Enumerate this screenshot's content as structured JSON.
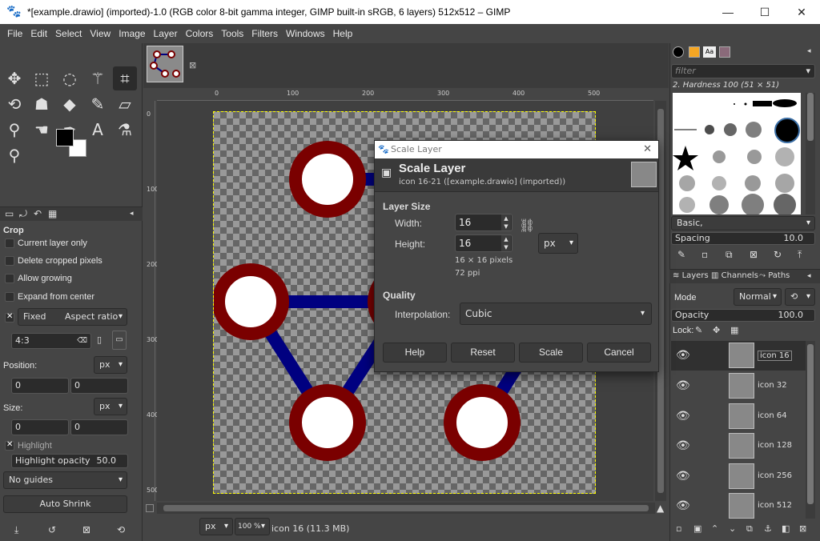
{
  "window": {
    "title": "*[example.drawio] (imported)-1.0 (RGB color 8-bit gamma integer, GIMP built-in sRGB, 6 layers) 512x512 – GIMP",
    "minimize": "—",
    "maximize": "☐",
    "close": "✕"
  },
  "menu": [
    "File",
    "Edit",
    "Select",
    "View",
    "Image",
    "Layer",
    "Colors",
    "Tools",
    "Filters",
    "Windows",
    "Help"
  ],
  "tool_options": {
    "title": "Crop",
    "current_layer_only": "Current layer only",
    "delete_cropped": "Delete cropped pixels",
    "allow_growing": "Allow growing",
    "expand_from_center": "Expand from center",
    "fixed": "Fixed",
    "aspect_ratio": "Aspect ratio",
    "ratio_value": "4:3",
    "position_label": "Position:",
    "position_unit": "px",
    "position_x": "0",
    "position_y": "0",
    "size_label": "Size:",
    "size_unit": "px",
    "size_w": "0",
    "size_h": "0",
    "highlight": "Highlight",
    "highlight_opacity_label": "Highlight opacity",
    "highlight_opacity_value": "50.0",
    "guides": "No guides",
    "auto_shrink": "Auto Shrink"
  },
  "rulers": {
    "top": [
      "0",
      "100",
      "200",
      "300",
      "400",
      "500"
    ],
    "left": [
      "0",
      "100",
      "200",
      "300",
      "400",
      "500"
    ]
  },
  "status": {
    "unit": "px",
    "zoom": "100 %",
    "info": "icon 16 (11.3 MB)"
  },
  "brushes": {
    "filter_placeholder": "filter",
    "selected": "2. Hardness 100 (51 × 51)",
    "preset": "Basic,",
    "spacing_label": "Spacing",
    "spacing_value": "10.0"
  },
  "layers_panel": {
    "tabs": [
      "Layers",
      "Channels",
      "Paths"
    ],
    "mode_label": "Mode",
    "mode_value": "Normal",
    "opacity_label": "Opacity",
    "opacity_value": "100.0",
    "lock_label": "Lock:",
    "layers": [
      "icon 16",
      "icon 32",
      "icon 64",
      "icon 128",
      "icon 256",
      "icon 512"
    ]
  },
  "dialog": {
    "window_title": "Scale Layer",
    "heading": "Scale Layer",
    "subheading": "icon 16-21 ([example.drawio] (imported))",
    "layer_size": "Layer Size",
    "width_label": "Width:",
    "width_value": "16",
    "height_label": "Height:",
    "height_value": "16",
    "unit": "px",
    "pixels_info": "16 × 16 pixels",
    "ppi_info": "72 ppi",
    "quality": "Quality",
    "interp_label": "Interpolation:",
    "interp_value": "Cubic",
    "help": "Help",
    "reset": "Reset",
    "scale": "Scale",
    "cancel": "Cancel"
  },
  "colors": {
    "node_ring": "#7a0000",
    "edge": "#000080",
    "node_fill": "#ffffff"
  }
}
